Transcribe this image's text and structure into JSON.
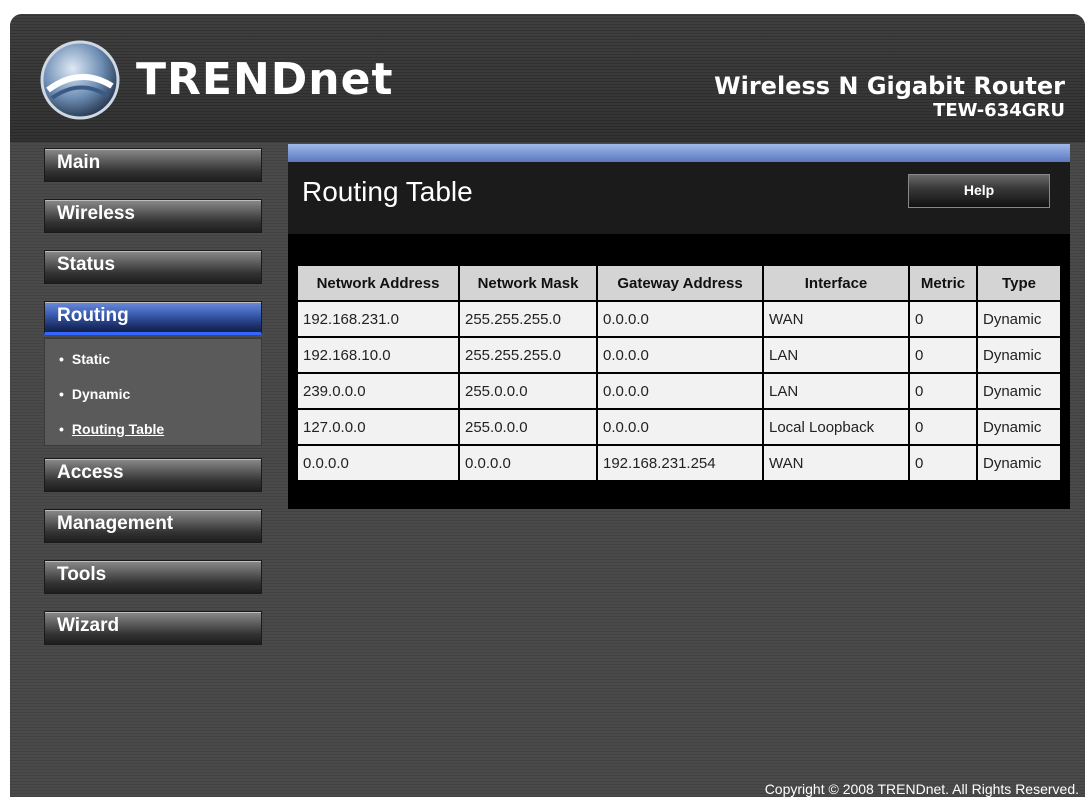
{
  "brand": {
    "logo_text": "TRENDnet",
    "product_line": "Wireless N Gigabit Router",
    "model": "TEW-634GRU"
  },
  "menu": {
    "main": "Main",
    "wireless": "Wireless",
    "status": "Status",
    "routing": "Routing",
    "routing_sub": [
      "Static",
      "Dynamic",
      "Routing Table"
    ],
    "access": "Access",
    "management": "Management",
    "tools": "Tools",
    "wizard": "Wizard"
  },
  "panel": {
    "title": "Routing Table",
    "help_label": "Help"
  },
  "table": {
    "headers": [
      "Network Address",
      "Network Mask",
      "Gateway Address",
      "Interface",
      "Metric",
      "Type"
    ],
    "rows": [
      [
        "192.168.231.0",
        "255.255.255.0",
        "0.0.0.0",
        "WAN",
        "0",
        "Dynamic"
      ],
      [
        "192.168.10.0",
        "255.255.255.0",
        "0.0.0.0",
        "LAN",
        "0",
        "Dynamic"
      ],
      [
        "239.0.0.0",
        "255.0.0.0",
        "0.0.0.0",
        "LAN",
        "0",
        "Dynamic"
      ],
      [
        "127.0.0.0",
        "255.0.0.0",
        "0.0.0.0",
        "Local Loopback",
        "0",
        "Dynamic"
      ],
      [
        "0.0.0.0",
        "0.0.0.0",
        "192.168.231.254",
        "WAN",
        "0",
        "Dynamic"
      ]
    ]
  },
  "footer": {
    "copyright": "Copyright © 2008 TRENDnet. All Rights Reserved."
  }
}
